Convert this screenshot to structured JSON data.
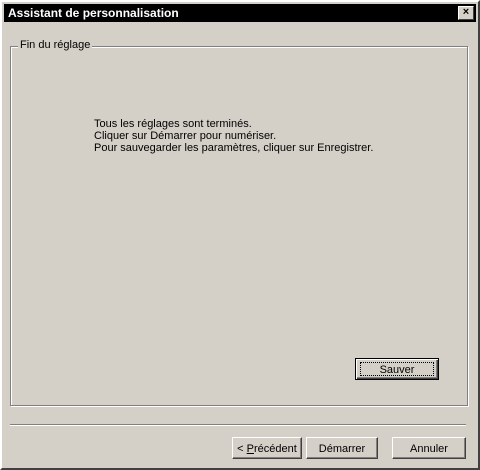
{
  "window": {
    "title": "Assistant de personnalisation",
    "close_glyph": "×"
  },
  "group": {
    "legend": "Fin du réglage"
  },
  "message": {
    "line1": "Tous les réglages sont terminés.",
    "line2": "Cliquer sur Démarrer pour numériser.",
    "line3": "Pour sauvegarder les paramètres, cliquer sur Enregistrer."
  },
  "buttons": {
    "save": "Sauver",
    "prev_prefix": "< ",
    "prev_mnemonic": "P",
    "prev_rest": "récédent",
    "start": "Démarrer",
    "cancel": "Annuler"
  }
}
